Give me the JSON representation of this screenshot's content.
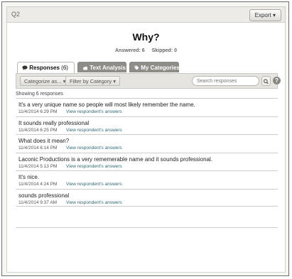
{
  "question": {
    "label": "Q2",
    "title": "Why?"
  },
  "export": {
    "label": "Export",
    "chevron": "▾"
  },
  "stats": {
    "answered": "Answered: 6",
    "skipped": "Skipped: 0"
  },
  "tabs": [
    {
      "label": "Responses",
      "count": "(6)",
      "icon": "speech-bubble-icon",
      "active": true
    },
    {
      "label": "Text Analysis",
      "icon": "cloud-icon",
      "active": false
    },
    {
      "label": "My Categories",
      "icon": "tag-icon",
      "active": false
    }
  ],
  "toolbar": {
    "categorize_label": "Categorize as...",
    "filter_label": "Filter by Category",
    "search_placeholder": "Search responses",
    "help_label": "?"
  },
  "showing_text": "Showing 6 responses",
  "link_label": "View respondent's answers",
  "responses": [
    {
      "text": "It's a very unique name so people will most likely remember the name.",
      "date": "11/4/2014 6:29 PM"
    },
    {
      "text": "It sounds really professional",
      "date": "11/4/2014 6:25 PM"
    },
    {
      "text": "What does it mean?",
      "date": "11/4/2014 6:14 PM"
    },
    {
      "text": "Laconic Productions is a very rememerable name and it sounds professional.",
      "date": "11/4/2014 5:13 PM"
    },
    {
      "text": "It's nice.",
      "date": "11/4/2014 4:24 PM"
    },
    {
      "text": "sounds professional",
      "date": "11/4/2014 9:37 AM"
    }
  ]
}
